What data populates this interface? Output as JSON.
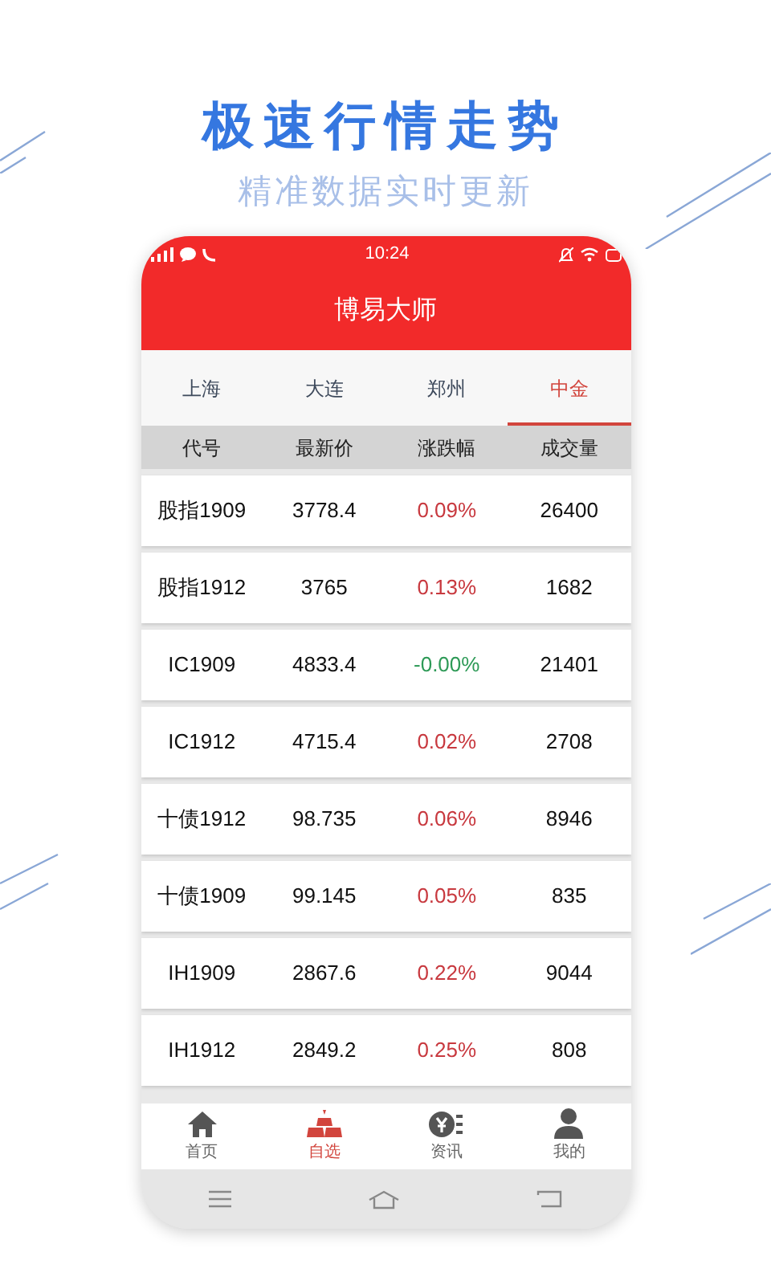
{
  "promo": {
    "headline": "极速行情走势",
    "subheadline": "精准数据实时更新"
  },
  "status_bar": {
    "time": "10:24"
  },
  "app": {
    "title": "博易大师"
  },
  "tabs": [
    {
      "label": "上海",
      "selected": false
    },
    {
      "label": "大连",
      "selected": false
    },
    {
      "label": "郑州",
      "selected": false
    },
    {
      "label": "中金",
      "selected": true
    }
  ],
  "table": {
    "columns": [
      "代号",
      "最新价",
      "涨跌幅",
      "成交量"
    ],
    "rows": [
      {
        "code": "股指1909",
        "price": "3778.4",
        "change": "0.09%",
        "volume": "26400",
        "color": "#c8393f"
      },
      {
        "code": "股指1912",
        "price": "3765",
        "change": "0.13%",
        "volume": "1682",
        "color": "#c8393f"
      },
      {
        "code": "IC1909",
        "price": "4833.4",
        "change": "-0.00%",
        "volume": "21401",
        "color": "#2e9a57"
      },
      {
        "code": "IC1912",
        "price": "4715.4",
        "change": "0.02%",
        "volume": "2708",
        "color": "#c8393f"
      },
      {
        "code": "十债1912",
        "price": "98.735",
        "change": "0.06%",
        "volume": "8946",
        "color": "#c8393f"
      },
      {
        "code": "十债1909",
        "price": "99.145",
        "change": "0.05%",
        "volume": "835",
        "color": "#c8393f"
      },
      {
        "code": "IH1909",
        "price": "2867.6",
        "change": "0.22%",
        "volume": "9044",
        "color": "#c8393f"
      },
      {
        "code": "IH1912",
        "price": "2849.2",
        "change": "0.25%",
        "volume": "808",
        "color": "#c8393f"
      }
    ]
  },
  "bottom_nav": [
    {
      "label": "首页",
      "selected": false
    },
    {
      "label": "自选",
      "selected": true
    },
    {
      "label": "资讯",
      "selected": false
    },
    {
      "label": "我的",
      "selected": false
    }
  ]
}
